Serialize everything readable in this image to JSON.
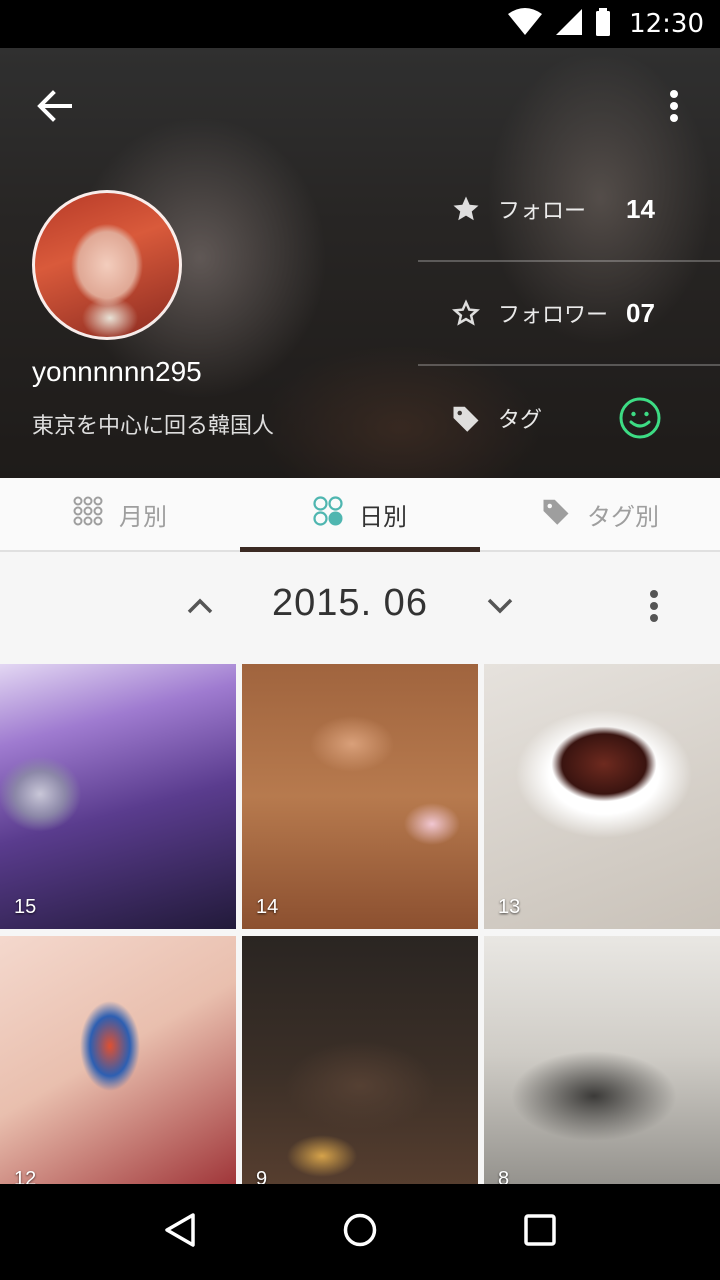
{
  "status_bar": {
    "time": "12:30",
    "icons": [
      "wifi-icon",
      "signal-icon",
      "battery-icon"
    ]
  },
  "header": {
    "back_icon": "arrow-back-icon",
    "more_icon": "more-vert-icon",
    "username": "yonnnnnn295",
    "bio": "東京を中心に回る韓国人",
    "stats": [
      {
        "icon": "star-filled-icon",
        "label": "フォロー",
        "value": "14"
      },
      {
        "icon": "star-outline-icon",
        "label": "フォロワー",
        "value": "07"
      },
      {
        "icon": "tag-icon",
        "label": "タグ",
        "value_icon": "smile-icon"
      }
    ]
  },
  "tabs": [
    {
      "label": "月別",
      "icon": "grid-dots-icon",
      "active": false
    },
    {
      "label": "日別",
      "icon": "four-circles-icon",
      "active": true
    },
    {
      "label": "タグ別",
      "icon": "tag-icon",
      "active": false
    }
  ],
  "month_nav": {
    "label": "2015. 06",
    "prev_icon": "chevron-up-icon",
    "next_icon": "chevron-down-icon",
    "more_icon": "more-vert-icon"
  },
  "photos": [
    {
      "day": "15"
    },
    {
      "day": "14"
    },
    {
      "day": "13"
    },
    {
      "day": "12"
    },
    {
      "day": "9"
    },
    {
      "day": "8"
    }
  ],
  "nav_bar": {
    "icons": [
      "back-triangle-icon",
      "home-circle-icon",
      "recents-square-icon"
    ]
  },
  "colors": {
    "accent_green": "#3ddc84",
    "teal": "#4fb6b0",
    "tab_indicator": "#3b2a23"
  }
}
